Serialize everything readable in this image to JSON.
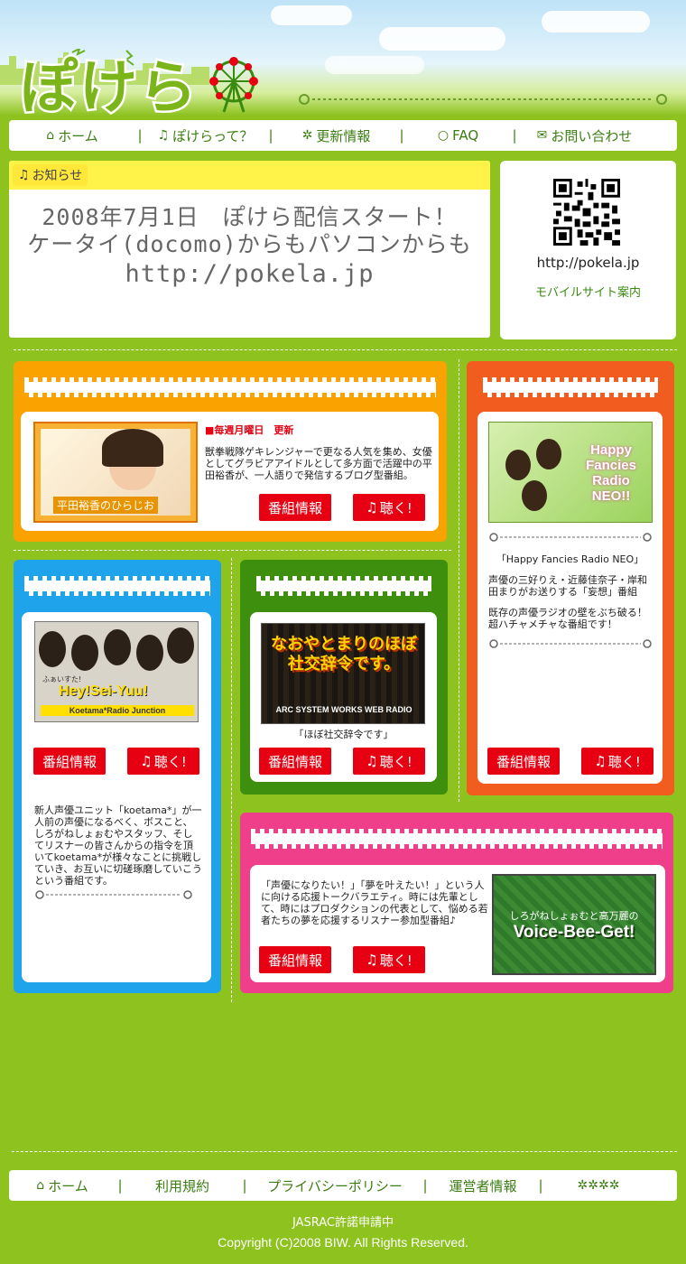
{
  "header": {
    "logo_text": "ぽけら"
  },
  "nav": {
    "items": [
      {
        "label": "ホーム",
        "icon": "home-icon"
      },
      {
        "label": "ぽけらって？",
        "icon": "music-note-icon"
      },
      {
        "label": "更新情報",
        "icon": "sparkle-icon"
      },
      {
        "label": "FAQ",
        "icon": "speech-icon"
      },
      {
        "label": "お問い合わせ",
        "icon": "mail-icon"
      }
    ]
  },
  "notice": {
    "title": "お知らせ",
    "line1": "2008年7月1日　ぽけら配信スタート！",
    "line2": "ケータイ(docomo)からもパソコンからも",
    "line3": "http://pokela.jp"
  },
  "mobile": {
    "url": "http://pokela.jp",
    "guide": "モバイルサイト案内"
  },
  "programs": {
    "hirata": {
      "photo_caption": "平田裕香のひらじお",
      "schedule": "■毎週月曜日　更新",
      "description": "獣拳戦隊ゲキレンジャーで更なる人気を集め、女優としてグラビアアイドルとして多方面で活躍中の平田裕香が、一人語りで発信するブログ型番組。",
      "info_label": "番組情報",
      "listen_label": "聴く!"
    },
    "happy": {
      "photo_text": "Happy Fancies Radio NEO!!",
      "title": "「Happy Fancies Radio NEO」",
      "description1": "声優の三好りえ・近藤佳奈子・岸和田まりがお送りする「妄想」番組",
      "description2": "既存の声優ラジオの壁をぶち破る！超ハチャメチャな番組です！",
      "info_label": "番組情報",
      "listen_label": "聴く!"
    },
    "koetama": {
      "photo_text": "Hey!Sei-Yuu!",
      "photo_sub": "Koetama*Radio Junction",
      "photo_small": "ふぁいすた!",
      "description": "新人声優ユニット「koetama*」が一人前の声優になるべく、ボスこと、しろがねしょぉむやスタッフ、そしてリスナーの皆さんからの指令を頂いてkoetama*が様々なことに挑戦していき、お互いに切磋琢磨していこうという番組です。",
      "info_label": "番組情報",
      "listen_label": "聴く!"
    },
    "hobo": {
      "photo_text": "なおやとまりのほぼ社交辞令です。",
      "photo_sub": "ARC SYSTEM WORKS WEB RADIO",
      "title": "「ほぼ社交辞令です」",
      "info_label": "番組情報",
      "listen_label": "聴く!"
    },
    "voice": {
      "photo_sub": "しろがねしょぉむと高万麗の",
      "photo_text": "Voice-Bee-Get!",
      "description": "「声優になりたい！」「夢を叶えたい！」という人に向ける応援トークバラエティ。時には先輩として、時にはプロダクションの代表として、悩める若者たちの夢を応援するリスナー参加型番組♪",
      "info_label": "番組情報",
      "listen_label": "聴く!"
    }
  },
  "footer": {
    "links": [
      "ホーム",
      "利用規約",
      "プライバシーポリシー",
      "運営者情報"
    ],
    "jasrac": "JASRAC許諾申請中",
    "copyright": "Copyright (C)2008 BIW. All Rights Reserved."
  },
  "colors": {
    "background": "#8dc21f",
    "orange": "#f9a200",
    "red": "#f25c1e",
    "blue": "#1fa3ea",
    "green": "#3f8f0f",
    "pink": "#ef3f8a",
    "button": "#e60012"
  }
}
